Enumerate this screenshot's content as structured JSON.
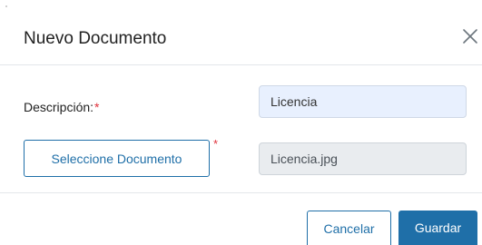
{
  "modal": {
    "title": "Nuevo Documento",
    "close_icon": "close-icon"
  },
  "form": {
    "description_label": "Descripción:",
    "required_marker": "*",
    "description_value": "Licencia",
    "select_document_label": "Seleccione Documento",
    "file_value": "Licencia.jpg"
  },
  "footer": {
    "cancel_label": "Cancelar",
    "save_label": "Guardar"
  },
  "colors": {
    "primary": "#1f6fa8",
    "required": "#e0323c",
    "autofill_bg": "#e8f0fe",
    "readonly_bg": "#e9ecef"
  }
}
